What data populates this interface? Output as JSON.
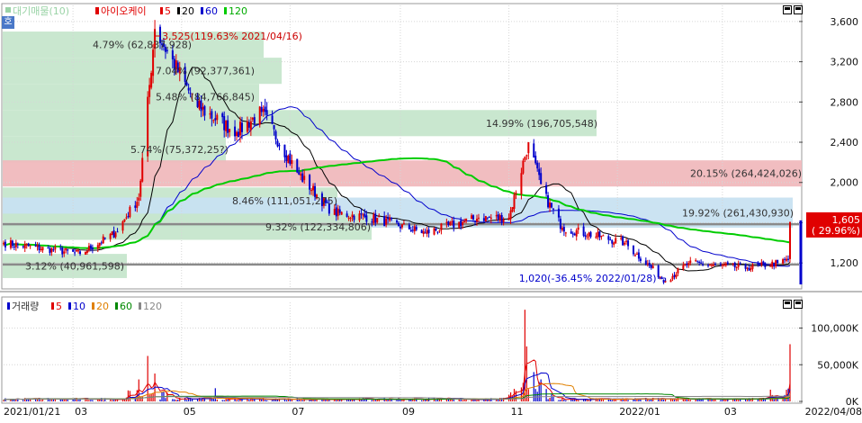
{
  "price_legend": {
    "indicator": "대기매물(10)",
    "stock_name": "아이오케이",
    "ma": [
      {
        "label": "5",
        "color": "#e00000"
      },
      {
        "label": "20",
        "color": "#000000"
      },
      {
        "label": "60",
        "color": "#0000cc"
      },
      {
        "label": "120",
        "color": "#00cc00"
      }
    ]
  },
  "volume_legend": {
    "title": "거래량",
    "ma": [
      {
        "label": "5",
        "color": "#e00000"
      },
      {
        "label": "10",
        "color": "#0000cc"
      },
      {
        "label": "20",
        "color": "#e08000"
      },
      {
        "label": "60",
        "color": "#008800"
      },
      {
        "label": "120",
        "color": "#888888"
      }
    ]
  },
  "side_tab": "호",
  "annotations": {
    "high": "3,525(119.63% 2021/04/16)",
    "low": "1,020(-36.45% 2022/01/28)",
    "current_price": "1,605",
    "current_change": "( 29.96%)"
  },
  "colors": {
    "up": "#e00000",
    "down": "#0000cc",
    "zone_green": "#c6e6cc",
    "zone_red": "#f0b9bd",
    "zone_blue": "#c8e1f1"
  },
  "chart_data": [
    {
      "type": "candlestick",
      "x_range": [
        "2021/01/21",
        "2022/04/08"
      ],
      "x_tick_labels": [
        "2021/01/21",
        "03",
        "05",
        "07",
        "09",
        "11",
        "2022/01",
        "03",
        "2022/04/08"
      ],
      "y_ticks": [
        1200,
        1600,
        2000,
        2400,
        2800,
        3200,
        3600
      ],
      "y_tick_labels": [
        "1,200",
        "1,600",
        "2,000",
        "2,400",
        "2,800",
        "3,200",
        "3,600"
      ],
      "ylim": [
        960,
        3760
      ],
      "grid": true,
      "key_points": [
        {
          "date": "2021/01/21",
          "close": 1400
        },
        {
          "date": "2021/03/05",
          "close": 1290
        },
        {
          "date": "2021/03/25",
          "close": 1500
        },
        {
          "date": "2021/04/07",
          "close": 1850
        },
        {
          "date": "2021/04/16",
          "close": 3525
        },
        {
          "date": "2021/05/10",
          "close": 2750
        },
        {
          "date": "2021/06/01",
          "close": 2500
        },
        {
          "date": "2021/06/15",
          "close": 2700
        },
        {
          "date": "2021/07/05",
          "close": 2100
        },
        {
          "date": "2021/07/25",
          "close": 1700
        },
        {
          "date": "2021/08/15",
          "close": 1650
        },
        {
          "date": "2021/09/15",
          "close": 1500
        },
        {
          "date": "2021/10/15",
          "close": 1650
        },
        {
          "date": "2021/11/01",
          "close": 1650
        },
        {
          "date": "2021/11/12",
          "close": 2400
        },
        {
          "date": "2021/11/20",
          "close": 1900
        },
        {
          "date": "2021/12/01",
          "close": 1550
        },
        {
          "date": "2022/01/05",
          "close": 1400
        },
        {
          "date": "2022/01/28",
          "close": 1020
        },
        {
          "date": "2022/02/10",
          "close": 1200
        },
        {
          "date": "2022/03/15",
          "close": 1150
        },
        {
          "date": "2022/04/01",
          "close": 1200
        },
        {
          "date": "2022/04/07",
          "close": 1230
        },
        {
          "date": "2022/04/08",
          "close": 1605
        }
      ],
      "high_point": {
        "date": "2021/04/16",
        "value": 3525
      },
      "low_point": {
        "date": "2022/01/28",
        "value": 1020
      },
      "last_price": 1605,
      "last_change_pct": 29.96,
      "horizontal_lines": [
        1585,
        1185
      ],
      "supply_zones": [
        {
          "from": 3240,
          "to": 3500,
          "label": "4.79% (62,837,928)",
          "color": "green"
        },
        {
          "from": 2980,
          "to": 3240,
          "label": "7.04% (92,377,361)",
          "color": "green"
        },
        {
          "from": 2720,
          "to": 2980,
          "label": "5.48% (84,766,845)",
          "color": "green"
        },
        {
          "from": 2200,
          "to": 2460,
          "label": "5.74% (75,372,25?)",
          "color": "green"
        },
        {
          "from": 2460,
          "to": 2720,
          "label": "14.99% (196,705,548)",
          "color": "green"
        },
        {
          "from": 1960,
          "to": 2220,
          "label": "20.15% (264,424,026)",
          "color": "red"
        },
        {
          "from": 1690,
          "to": 1950,
          "label": "8.46% (111,051,275)",
          "color": "green"
        },
        {
          "from": 1550,
          "to": 1850,
          "label": "19.92% (261,430,930)",
          "color": "blue"
        },
        {
          "from": 1430,
          "to": 1690,
          "label": "9.32% (122,334,806)",
          "color": "green"
        },
        {
          "from": 1050,
          "to": 1290,
          "label": "3.12% (40,961,598)",
          "color": "green"
        }
      ]
    },
    {
      "type": "bar",
      "name": "거래량",
      "y_ticks": [
        0,
        50000,
        100000
      ],
      "y_tick_labels": [
        "0K",
        "50,000K",
        "100,000K"
      ],
      "ylim": [
        0,
        135000
      ],
      "spikes": [
        {
          "date": "2021/04/07",
          "value": 30000
        },
        {
          "date": "2021/04/12",
          "value": 62000
        },
        {
          "date": "2021/04/16",
          "value": 38000
        },
        {
          "date": "2021/05/20",
          "value": 18000
        },
        {
          "date": "2021/11/10",
          "value": 125000
        },
        {
          "date": "2021/11/11",
          "value": 75000
        },
        {
          "date": "2021/11/15",
          "value": 40000
        },
        {
          "date": "2022/04/08",
          "value": 78000
        }
      ]
    }
  ]
}
